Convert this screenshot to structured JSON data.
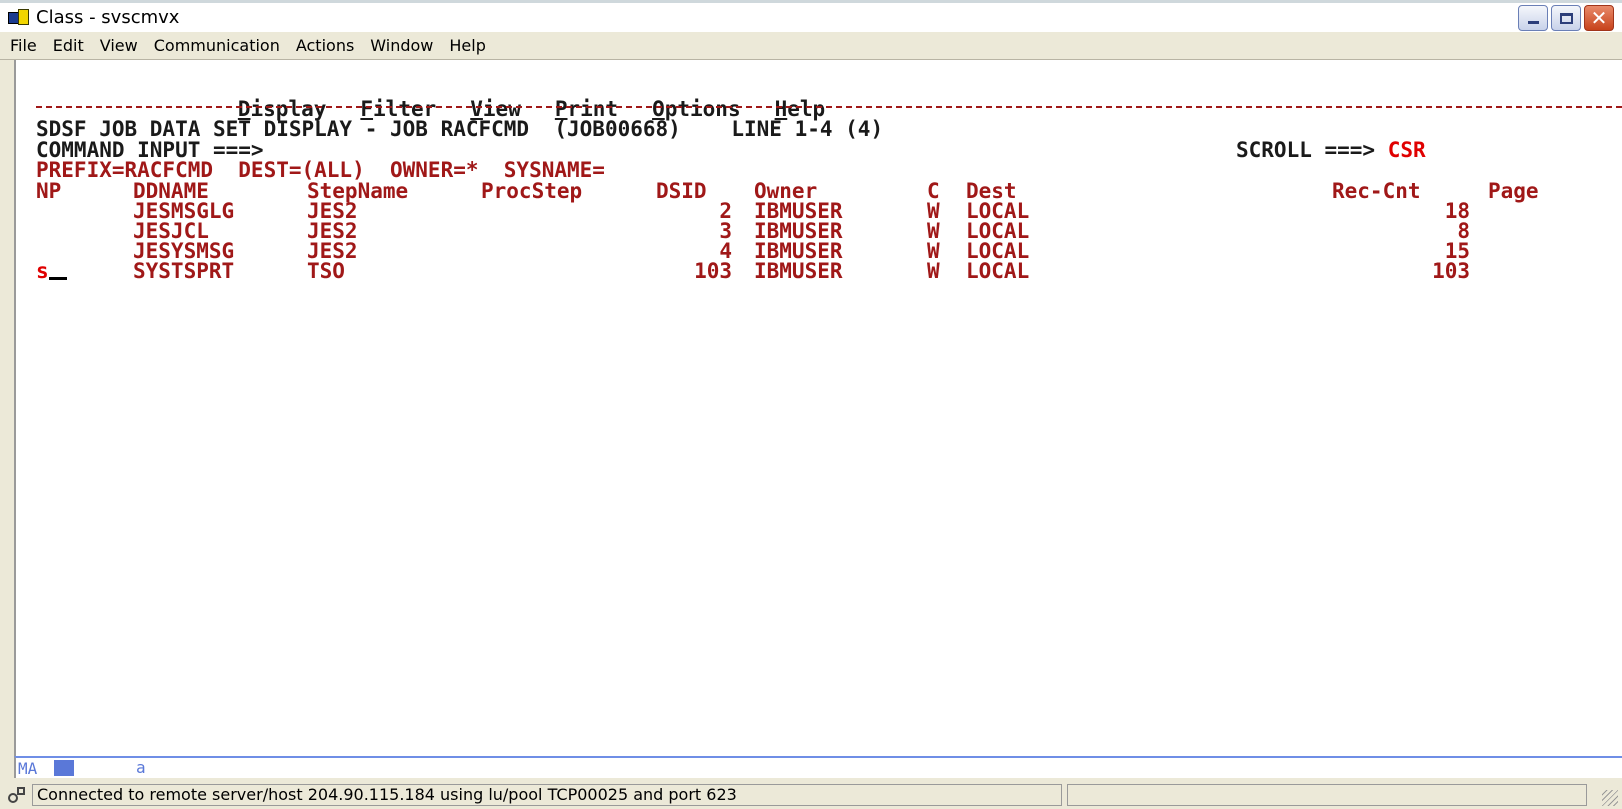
{
  "window": {
    "title": "Class - svscmvx",
    "icon": "pc3270-session-icon"
  },
  "menubar": [
    "File",
    "Edit",
    "View",
    "Communication",
    "Actions",
    "Window",
    "Help"
  ],
  "actionbar": [
    {
      "hot": "D",
      "rest": "isplay"
    },
    {
      "hot": "F",
      "rest": "ilter"
    },
    {
      "hot": "V",
      "rest": "iew"
    },
    {
      "hot": "P",
      "rest": "rint"
    },
    {
      "hot": "O",
      "rest": "ptions"
    },
    {
      "hot": "H",
      "rest": "elp"
    }
  ],
  "screen": {
    "header_line": "SDSF JOB DATA SET DISPLAY - JOB RACFCMD  (JOB00668)    LINE 1-4 (4)",
    "command_label": "COMMAND INPUT ===>",
    "command_value": "",
    "scroll_label": "SCROLL ===>",
    "scroll_value": "CSR",
    "filter_line": "PREFIX=RACFCMD  DEST=(ALL)  OWNER=*  SYSNAME=",
    "columns": [
      "NP",
      "DDNAME",
      "StepName",
      "ProcStep",
      "DSID",
      "Owner",
      "C",
      "Dest",
      "Rec-Cnt",
      "Page"
    ],
    "rows": [
      {
        "np": "",
        "ddname": "JESMSGLG",
        "stepname": "JES2",
        "procstep": "",
        "dsid": "2",
        "owner": "IBMUSER",
        "c": "W",
        "dest": "LOCAL",
        "reccnt": "18"
      },
      {
        "np": "",
        "ddname": "JESJCL",
        "stepname": "JES2",
        "procstep": "",
        "dsid": "3",
        "owner": "IBMUSER",
        "c": "W",
        "dest": "LOCAL",
        "reccnt": "8"
      },
      {
        "np": "",
        "ddname": "JESYSMSG",
        "stepname": "JES2",
        "procstep": "",
        "dsid": "4",
        "owner": "IBMUSER",
        "c": "W",
        "dest": "LOCAL",
        "reccnt": "15"
      },
      {
        "np": "s",
        "ddname": "SYSTSPRT",
        "stepname": "TSO",
        "procstep": "",
        "dsid": "103",
        "owner": "IBMUSER",
        "c": "W",
        "dest": "LOCAL",
        "reccnt": "103"
      }
    ]
  },
  "oia": {
    "mode": "MA",
    "indicator": "a"
  },
  "statusbar": {
    "connection": "Connected to remote server/host 204.90.115.184 using lu/pool TCP00025 and port 623"
  },
  "colors": {
    "field_text": "#a01818",
    "scroll_value": "#e00000",
    "oia": "#5a78d8"
  }
}
